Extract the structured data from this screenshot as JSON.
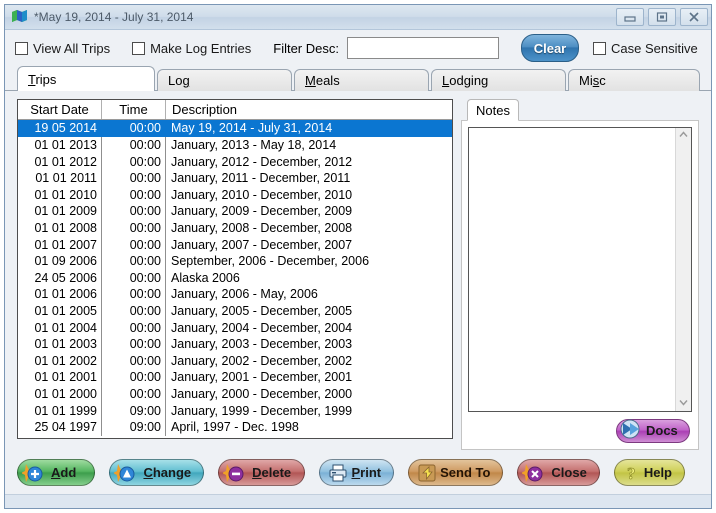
{
  "window": {
    "title": "*May 19, 2014 - July 31, 2014",
    "app_icon": "map-icon",
    "controls": {
      "minimize": "minimize-icon",
      "maximize": "maximize-icon",
      "close": "close-icon"
    }
  },
  "toolbar": {
    "view_all_trips_label": "View All Trips",
    "view_all_trips_checked": false,
    "make_log_entries_label": "Make Log Entries",
    "make_log_entries_checked": false,
    "filter_label": "Filter Desc:",
    "filter_value": "",
    "filter_placeholder": "",
    "clear_label": "Clear",
    "case_sensitive_label": "Case Sensitive",
    "case_sensitive_checked": false
  },
  "tabs": [
    {
      "label": "Trips",
      "mnemonic": "T",
      "active": true
    },
    {
      "label": "Log",
      "mnemonic": "g",
      "active": false
    },
    {
      "label": "Meals",
      "mnemonic": "M",
      "active": false
    },
    {
      "label": "Lodging",
      "mnemonic": "L",
      "active": false
    },
    {
      "label": "Misc",
      "mnemonic": "s",
      "active": false
    }
  ],
  "list": {
    "columns": [
      "Start Date",
      "Time",
      "Description"
    ],
    "rows": [
      {
        "date": "19 05 2014",
        "time": "00:00",
        "desc": "May 19, 2014 - July 31, 2014",
        "selected": true
      },
      {
        "date": "01 01 2013",
        "time": "00:00",
        "desc": "January, 2013 - May 18, 2014",
        "selected": false
      },
      {
        "date": "01 01 2012",
        "time": "00:00",
        "desc": "January, 2012 - December, 2012",
        "selected": false
      },
      {
        "date": "01 01 2011",
        "time": "00:00",
        "desc": "January, 2011 - December, 2011",
        "selected": false
      },
      {
        "date": "01 01 2010",
        "time": "00:00",
        "desc": "January, 2010 - December, 2010",
        "selected": false
      },
      {
        "date": "01 01 2009",
        "time": "00:00",
        "desc": "January, 2009 - December, 2009",
        "selected": false
      },
      {
        "date": "01 01 2008",
        "time": "00:00",
        "desc": "January, 2008 - December, 2008",
        "selected": false
      },
      {
        "date": "01 01 2007",
        "time": "00:00",
        "desc": "January, 2007 - December, 2007",
        "selected": false
      },
      {
        "date": "01 09 2006",
        "time": "00:00",
        "desc": "September, 2006 - December, 2006",
        "selected": false
      },
      {
        "date": "24 05 2006",
        "time": "00:00",
        "desc": "Alaska 2006",
        "selected": false
      },
      {
        "date": "01 01 2006",
        "time": "00:00",
        "desc": "January, 2006 - May, 2006",
        "selected": false
      },
      {
        "date": "01 01 2005",
        "time": "00:00",
        "desc": "January, 2005 - December, 2005",
        "selected": false
      },
      {
        "date": "01 01 2004",
        "time": "00:00",
        "desc": "January, 2004 - December, 2004",
        "selected": false
      },
      {
        "date": "01 01 2003",
        "time": "00:00",
        "desc": "January, 2003 - December, 2003",
        "selected": false
      },
      {
        "date": "01 01 2002",
        "time": "00:00",
        "desc": "January, 2002 - December, 2002",
        "selected": false
      },
      {
        "date": "01 01 2001",
        "time": "00:00",
        "desc": "January, 2001 - December, 2001",
        "selected": false
      },
      {
        "date": "01 01 2000",
        "time": "00:00",
        "desc": "January, 2000 - December, 2000",
        "selected": false
      },
      {
        "date": "01 01 1999",
        "time": "09:00",
        "desc": "January, 1999 - December, 1999",
        "selected": false
      },
      {
        "date": "25 04 1997",
        "time": "09:00",
        "desc": "April, 1997 - Dec. 1998",
        "selected": false
      }
    ]
  },
  "notes": {
    "tab_label": "Notes",
    "text": "",
    "placeholder": "",
    "scroll_up_icon": "chevron-up-icon",
    "scroll_down_icon": "chevron-down-icon",
    "docs_label": "Docs",
    "docs_icon": "send-arrow-icon"
  },
  "buttons": [
    {
      "label": "Add",
      "mnemonic": "A",
      "icon": "plus-circle-icon",
      "color": "#55b661"
    },
    {
      "label": "Change",
      "mnemonic": "C",
      "icon": "edit-circle-icon",
      "color": "#62bfd1"
    },
    {
      "label": "Delete",
      "mnemonic": "D",
      "icon": "delete-circle-icon",
      "color": "#c4706f"
    },
    {
      "label": "Print",
      "mnemonic": "P",
      "icon": "printer-icon",
      "color": "#93c2e0"
    },
    {
      "label": "Send To",
      "mnemonic": "",
      "icon": "arrow-curve-icon",
      "color": "#cf9b63"
    },
    {
      "label": "Close",
      "mnemonic": "",
      "icon": "x-circle-icon",
      "color": "#c4706f"
    },
    {
      "label": "Help",
      "mnemonic": "",
      "icon": "question-mark-icon",
      "color": "#cfd059"
    }
  ]
}
